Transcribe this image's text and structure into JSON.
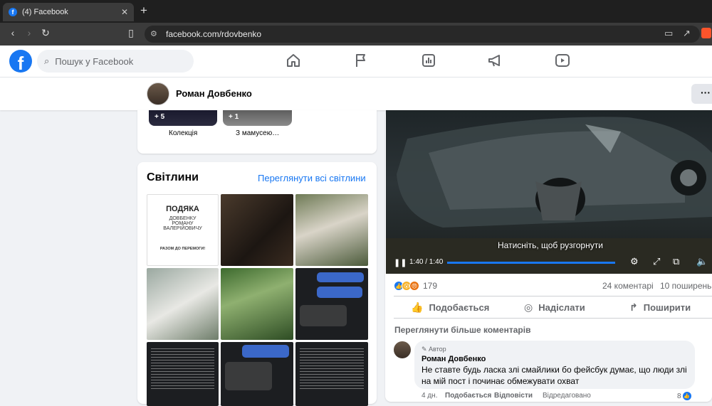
{
  "browser": {
    "tab_title": "(4) Facebook",
    "tab_favicon": "f",
    "close_glyph": "✕",
    "newtab_glyph": "+",
    "url": "facebook.com/rdovbenko"
  },
  "fb": {
    "logo": "f",
    "search_placeholder": "Пошук у Facebook",
    "nav_icons": [
      "home-icon",
      "flag-icon",
      "chart-icon",
      "megaphone-icon",
      "video-icon"
    ]
  },
  "profile": {
    "name": "Роман Довбенко",
    "more_label": "···"
  },
  "collections": [
    {
      "count": "+ 5",
      "label": "Колекція"
    },
    {
      "count": "+ 1",
      "label": "З мамусею…"
    }
  ],
  "photos": {
    "title": "Світлини",
    "see_all": "Переглянути всі світлини",
    "items": [
      {
        "kind": "certificate",
        "text": [
          "ПОДЯКА",
          "ДОВБЕНКУ",
          "РОМАНУ",
          "ВАЛЕРІЙОВИЧУ",
          "РАЗОМ ДО ПЕРЕМОГИ!"
        ]
      },
      {
        "kind": "photo"
      },
      {
        "kind": "photo"
      },
      {
        "kind": "photo"
      },
      {
        "kind": "photo"
      },
      {
        "kind": "chat"
      },
      {
        "kind": "text"
      },
      {
        "kind": "chat"
      },
      {
        "kind": "text"
      }
    ]
  },
  "post": {
    "video_hint": "Натисніть, щоб рузгорнути",
    "video_time": "1:40 / 1:40",
    "reactions_count": "179",
    "comments": "24 коментарі",
    "shares": "10 поширень",
    "actions": [
      {
        "icon": "thumbs-up-icon",
        "label": "Подобається"
      },
      {
        "icon": "messenger-icon",
        "label": "Надіслати"
      },
      {
        "icon": "share-icon",
        "label": "Поширити"
      }
    ],
    "more_comments": "Переглянути більше коментарів",
    "comment": {
      "author_badge": "Автор",
      "name": "Роман Довбенко",
      "text": "Не ставте будь ласка злі смайлики бо фейсбук думає, що люди злі на мій пост і починає обмежувати охват",
      "age": "4 дн.",
      "like": "Подобається",
      "reply": "Відповісти",
      "edited": "Відредаговано",
      "likes": "8"
    }
  }
}
